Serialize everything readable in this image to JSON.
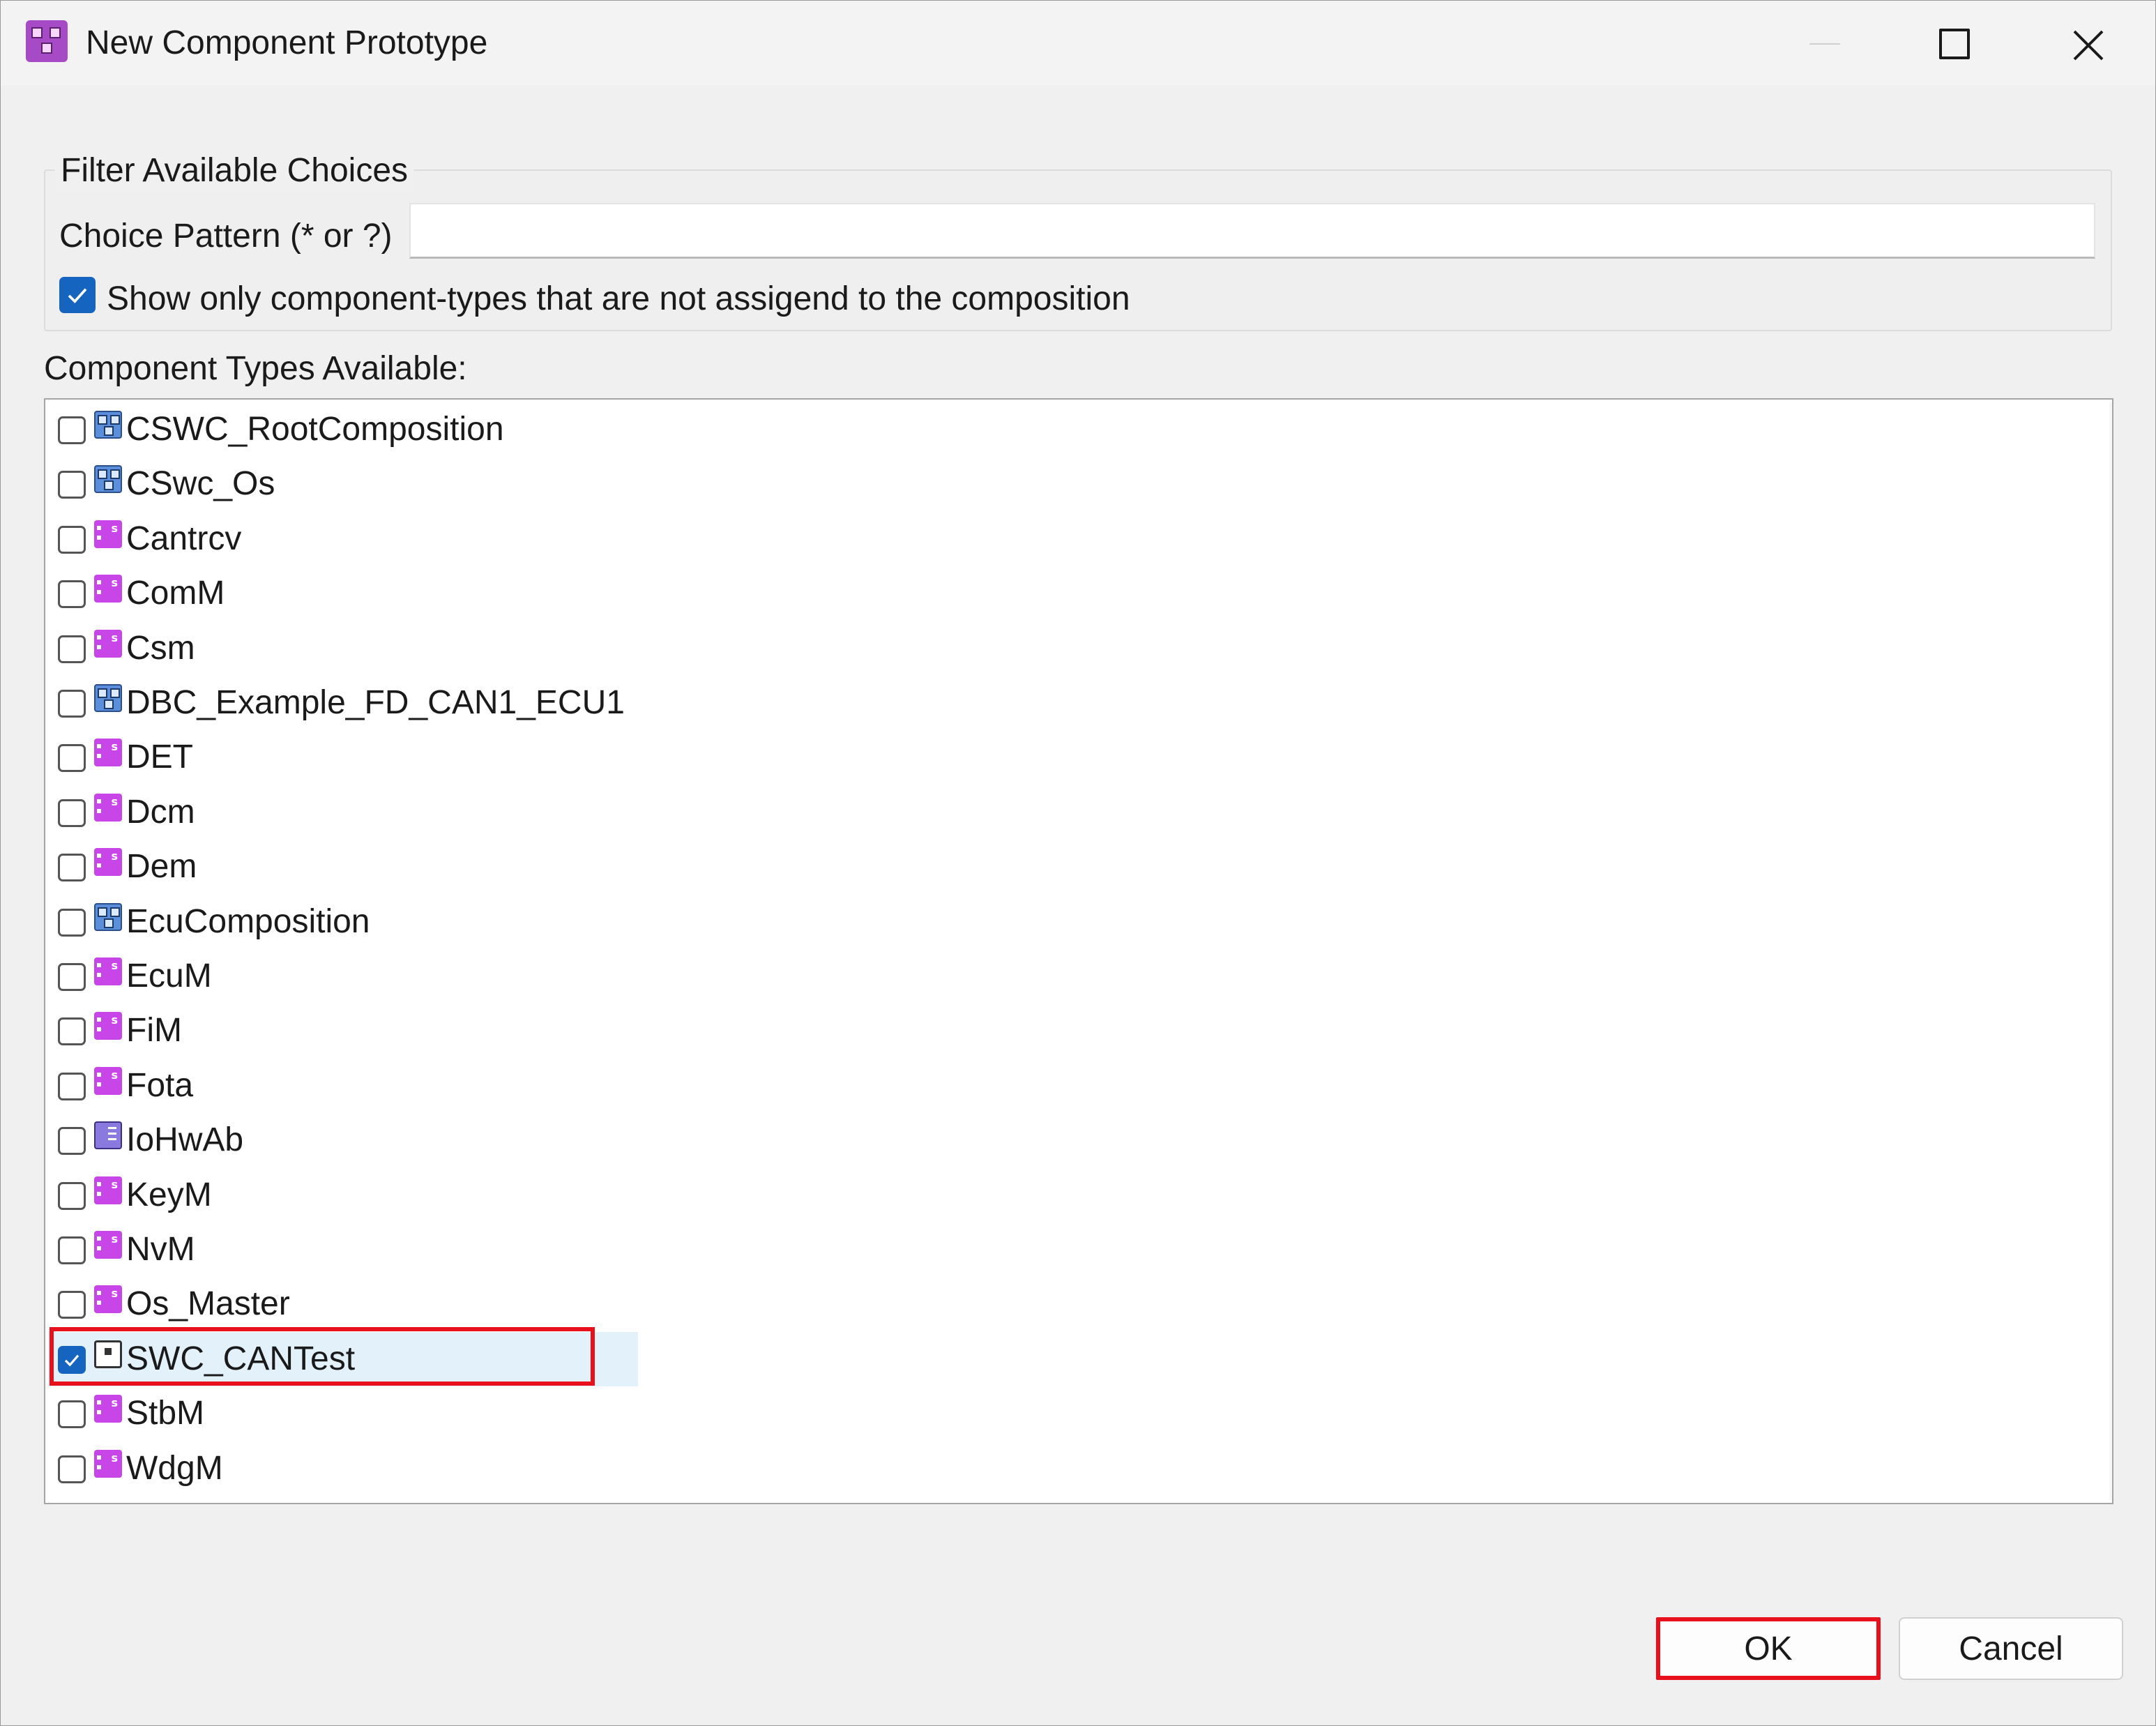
{
  "window": {
    "title": "New Component Prototype"
  },
  "filter": {
    "group_label": "Filter Available Choices",
    "pattern_label": "Choice Pattern (* or ?)",
    "pattern_value": "",
    "show_unassigned_label": "Show only component-types that are not assigend to the composition",
    "show_unassigned_checked": true
  },
  "list": {
    "label": "Component Types Available:",
    "items": [
      {
        "label": "CSWC_RootComposition",
        "icon": "composition-icon",
        "checked": false
      },
      {
        "label": "CSwc_Os",
        "icon": "composition-icon",
        "checked": false
      },
      {
        "label": "Cantrcv",
        "icon": "service-component-icon",
        "checked": false
      },
      {
        "label": "ComM",
        "icon": "service-component-icon",
        "checked": false
      },
      {
        "label": "Csm",
        "icon": "service-component-icon",
        "checked": false
      },
      {
        "label": "DBC_Example_FD_CAN1_ECU1",
        "icon": "composition-icon",
        "checked": false
      },
      {
        "label": "DET",
        "icon": "service-component-icon",
        "checked": false
      },
      {
        "label": "Dcm",
        "icon": "service-component-icon",
        "checked": false
      },
      {
        "label": "Dem",
        "icon": "service-component-icon",
        "checked": false
      },
      {
        "label": "EcuComposition",
        "icon": "composition-icon",
        "checked": false
      },
      {
        "label": "EcuM",
        "icon": "service-component-icon",
        "checked": false
      },
      {
        "label": "FiM",
        "icon": "service-component-icon",
        "checked": false
      },
      {
        "label": "Fota",
        "icon": "service-component-icon",
        "checked": false
      },
      {
        "label": "IoHwAb",
        "icon": "io-hw-abstraction-icon",
        "checked": false
      },
      {
        "label": "KeyM",
        "icon": "service-component-icon",
        "checked": false
      },
      {
        "label": "NvM",
        "icon": "service-component-icon",
        "checked": false
      },
      {
        "label": "Os_Master",
        "icon": "service-component-icon",
        "checked": false
      },
      {
        "label": "SWC_CANTest",
        "icon": "application-component-icon",
        "checked": true
      },
      {
        "label": "StbM",
        "icon": "service-component-icon",
        "checked": false
      },
      {
        "label": "WdgM",
        "icon": "service-component-icon",
        "checked": false
      }
    ]
  },
  "buttons": {
    "ok": "OK",
    "cancel": "Cancel"
  },
  "colors": {
    "highlight": "#e8101a",
    "accent": "#1565c0",
    "selection": "#e3f1fb"
  }
}
